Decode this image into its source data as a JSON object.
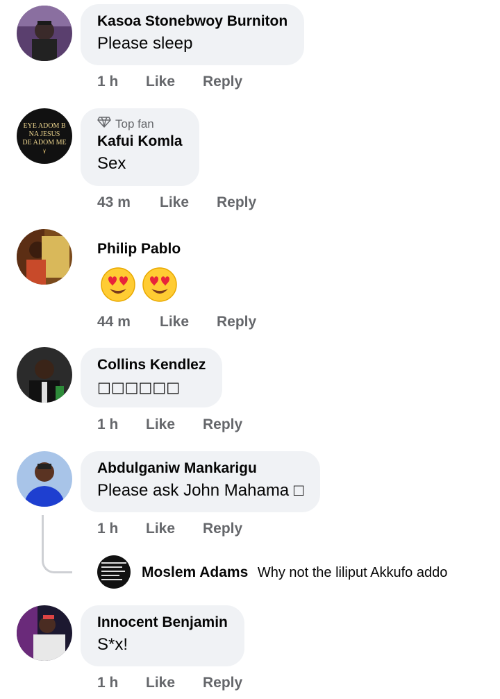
{
  "comments": [
    {
      "name": "Kasoa Stonebwoy Burniton",
      "text": "Please sleep",
      "time": "1 h",
      "like": "Like",
      "reply": "Reply"
    },
    {
      "badge": "Top fan",
      "name": "Kafui Komla",
      "text": "Sex",
      "time": "43 m",
      "like": "Like",
      "reply": "Reply",
      "avatar_text": [
        "EYE ADOM B",
        "NA JESUS",
        "DE ADOM ME"
      ]
    },
    {
      "name": "Philip Pablo",
      "emojis": [
        "heart-eyes-emoji",
        "heart-eyes-emoji"
      ],
      "time": "44 m",
      "like": "Like",
      "reply": "Reply"
    },
    {
      "name": "Collins Kendlez",
      "text": "□□□□□□",
      "time": "1 h",
      "like": "Like",
      "reply": "Reply"
    },
    {
      "name": "Abdulganiw Mankarigu",
      "text": "Please ask John Mahama □",
      "time": "1 h",
      "like": "Like",
      "reply": "Reply",
      "reply_preview": {
        "name": "Moslem Adams",
        "text": "Why not the liliput Akkufo addo"
      }
    },
    {
      "name": "Innocent Benjamin",
      "text": "S*x!",
      "time": "1 h",
      "like": "Like",
      "reply": "Reply"
    }
  ],
  "colors": {
    "bubble": "#f0f2f5",
    "secondary_text": "#65676b",
    "primary_text": "#050505",
    "thread_line": "#ced0d4"
  },
  "icons": {
    "top_fan": "diamond-icon"
  }
}
